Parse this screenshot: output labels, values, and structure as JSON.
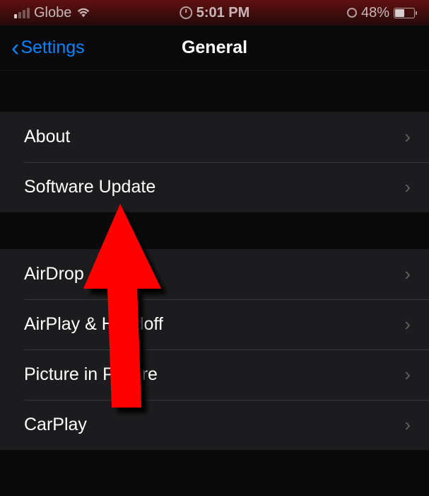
{
  "status": {
    "carrier": "Globe",
    "time": "5:01 PM",
    "battery_pct": "48%"
  },
  "nav": {
    "back_label": "Settings",
    "title": "General"
  },
  "groups": [
    {
      "rows": [
        {
          "label": "About"
        },
        {
          "label": "Software Update"
        }
      ]
    },
    {
      "rows": [
        {
          "label": "AirDrop"
        },
        {
          "label": "AirPlay & Handoff"
        },
        {
          "label": "Picture in Picture"
        },
        {
          "label": "CarPlay"
        }
      ]
    }
  ]
}
